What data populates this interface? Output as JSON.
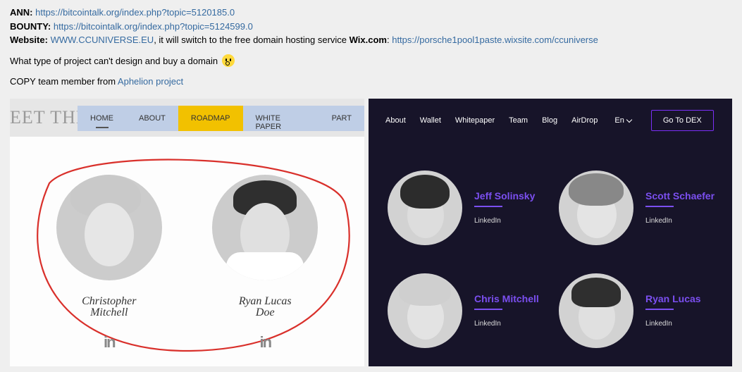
{
  "header": {
    "ann_label": "ANN:",
    "ann_url": "https://bitcointalk.org/index.php?topic=5120185.0",
    "bounty_label": "BOUNTY:",
    "bounty_url": "https://bitcointalk.org/index.php?topic=5124599.0",
    "website_label": "Website:",
    "website_url": "WWW.CCUNIVERSE.EU",
    "website_note1": ", it will switch to the free domain hosting service ",
    "wix": "Wix.com",
    "colon": ": ",
    "wix_url": "https://porsche1pool1paste.wixsite.com/ccuniverse",
    "question": "What type of project can't design and buy a domain",
    "copy_prefix": "COPY team member from ",
    "copy_link": "Aphelion project"
  },
  "left": {
    "bg_title": "EET THE TEAM",
    "nav": {
      "home": "HOME",
      "about": "ABOUT",
      "roadmap": "ROADMAP",
      "whitepaper": "WHITE PAPER",
      "partners": "PART"
    },
    "members": [
      {
        "name_line1": "Christopher",
        "name_line2": "Mitchell",
        "linkedin": "in"
      },
      {
        "name_line1": "Ryan Lucas",
        "name_line2": "Doe",
        "linkedin": "in"
      }
    ]
  },
  "right": {
    "nav": {
      "about": "About",
      "wallet": "Wallet",
      "whitepaper": "Whitepaper",
      "team": "Team",
      "blog": "Blog",
      "airdrop": "AirDrop",
      "lang": "En",
      "dex": "Go To DEX"
    },
    "members": [
      {
        "name": "Jeff Solinsky",
        "linkedin": "LinkedIn"
      },
      {
        "name": "Scott Schaefer",
        "linkedin": "LinkedIn"
      },
      {
        "name": "Chris Mitchell",
        "linkedin": "LinkedIn"
      },
      {
        "name": "Ryan Lucas",
        "linkedin": "LinkedIn"
      }
    ]
  }
}
